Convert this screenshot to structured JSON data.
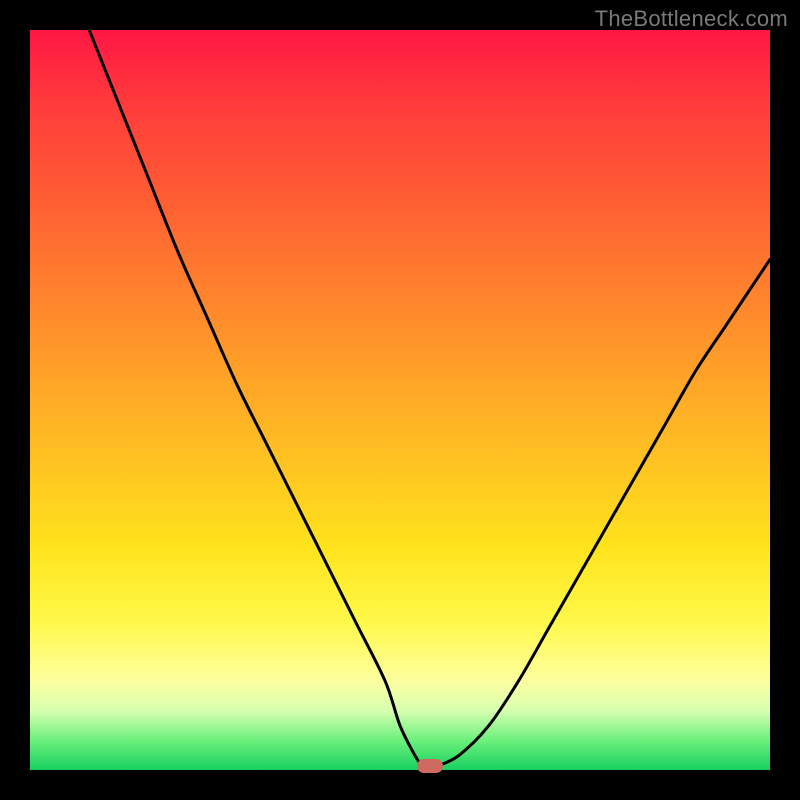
{
  "watermark": "TheBottleneck.com",
  "colors": {
    "frame_bg": "#000000",
    "curve_stroke": "#000000",
    "marker_fill": "#cf6a61",
    "gradient": [
      "#ff1744",
      "#ff3b3b",
      "#ff5b34",
      "#ff7e2e",
      "#ffa028",
      "#ffc222",
      "#ffe31c",
      "#fff94a",
      "#fdffa0",
      "#d6ffb0",
      "#6cf07c",
      "#18d060"
    ]
  },
  "chart_data": {
    "type": "line",
    "title": "",
    "xlabel": "",
    "ylabel": "",
    "xlim": [
      0,
      100
    ],
    "ylim": [
      0,
      100
    ],
    "series": [
      {
        "name": "left-branch",
        "x": [
          8,
          12,
          16,
          20,
          24,
          28,
          32,
          36,
          40,
          44,
          48,
          50,
          52,
          53
        ],
        "y": [
          100,
          90,
          80,
          70,
          61,
          52,
          44,
          36,
          28,
          20,
          12,
          6,
          2,
          0.5
        ]
      },
      {
        "name": "right-branch",
        "x": [
          55,
          58,
          62,
          66,
          70,
          74,
          78,
          82,
          86,
          90,
          94,
          98,
          100
        ],
        "y": [
          0.5,
          2,
          6,
          12,
          19,
          26,
          33,
          40,
          47,
          54,
          60,
          66,
          69
        ]
      }
    ],
    "marker": {
      "x": 54,
      "y": 0.5
    },
    "annotations": []
  }
}
